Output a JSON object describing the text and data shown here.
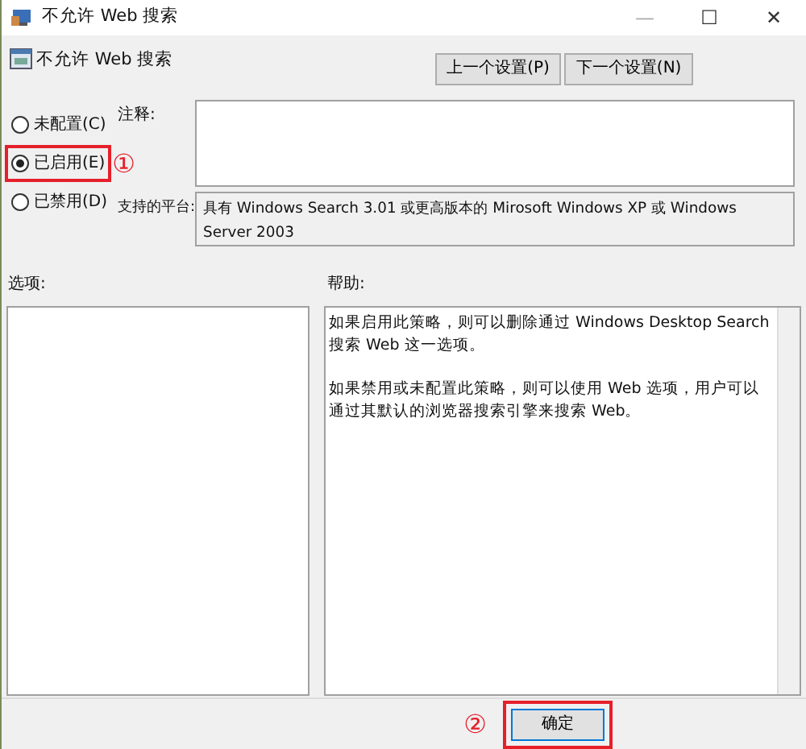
{
  "window": {
    "title": "不允许 Web 搜索",
    "controls": [
      "—",
      "☐",
      "✕"
    ]
  },
  "header": {
    "title": "不允许 Web 搜索",
    "buttons": [
      {
        "label": "上一个设置(P)"
      },
      {
        "label": "下一个设置(N)"
      }
    ]
  },
  "states": [
    {
      "label": "未配置(C)",
      "selected": false,
      "highlighted": false
    },
    {
      "label": "已启用(E)",
      "selected": true,
      "highlighted": true,
      "annotation": "①"
    },
    {
      "label": "已禁用(D)",
      "selected": false,
      "highlighted": false
    }
  ],
  "comment": {
    "label": "注释:"
  },
  "platform": {
    "label": "支持的平台:",
    "text": "具有 Windows Search 3.01 或更高版本的 Mirosoft Windows XP 或 Windows Server 2003"
  },
  "options": {
    "label": "选项:"
  },
  "help": {
    "label": "帮助:",
    "paragraphs": [
      "如果启用此策略，则可以删除通过 Windows Desktop Search 搜索 Web 这一选项。",
      "如果禁用或未配置此策略，则可以使用 Web 选项，用户可以通过其默认的浏览器搜索引擎来搜索 Web。"
    ]
  },
  "footer": {
    "buttons": [
      {
        "label": "确定",
        "default": true,
        "highlighted": true,
        "annotation": "②"
      }
    ]
  }
}
